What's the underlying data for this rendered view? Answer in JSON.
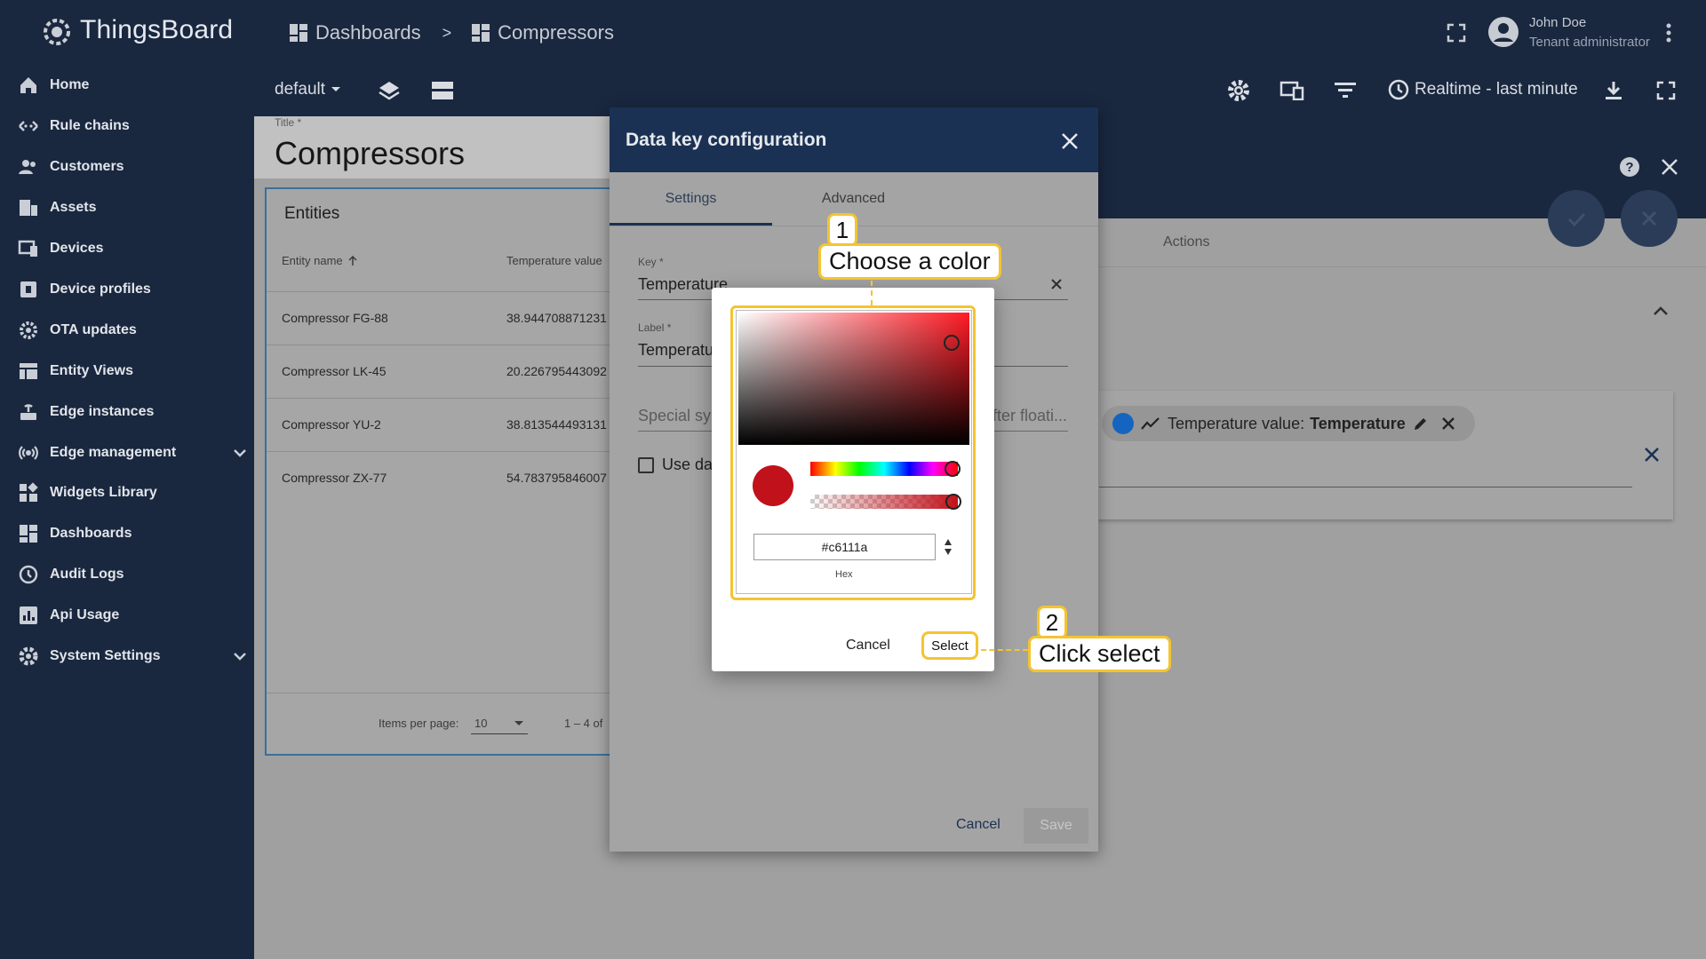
{
  "app": {
    "name": "ThingsBoard"
  },
  "breadcrumb": {
    "dashboards": "Dashboards",
    "separator": ">",
    "current": "Compressors"
  },
  "user": {
    "name": "John Doe",
    "role": "Tenant administrator"
  },
  "sidebar": {
    "items": [
      {
        "label": "Home",
        "icon": "home-icon"
      },
      {
        "label": "Rule chains",
        "icon": "rule-chain-icon"
      },
      {
        "label": "Customers",
        "icon": "customers-icon"
      },
      {
        "label": "Assets",
        "icon": "assets-icon"
      },
      {
        "label": "Devices",
        "icon": "devices-icon"
      },
      {
        "label": "Device profiles",
        "icon": "device-profile-icon"
      },
      {
        "label": "OTA updates",
        "icon": "ota-icon"
      },
      {
        "label": "Entity Views",
        "icon": "entity-views-icon"
      },
      {
        "label": "Edge instances",
        "icon": "edge-icon"
      },
      {
        "label": "Edge management",
        "icon": "edge-management-icon",
        "expandable": true
      },
      {
        "label": "Widgets Library",
        "icon": "widgets-icon"
      },
      {
        "label": "Dashboards",
        "icon": "dashboards-icon"
      },
      {
        "label": "Audit Logs",
        "icon": "audit-icon"
      },
      {
        "label": "Api Usage",
        "icon": "api-usage-icon"
      },
      {
        "label": "System Settings",
        "icon": "settings-icon",
        "expandable": true
      }
    ]
  },
  "toolbar": {
    "state": "default",
    "timewindow": "Realtime - last minute"
  },
  "dashboard": {
    "title_label": "Title *",
    "title": "Compressors",
    "widget_title": "Entities",
    "columns": [
      "Entity name",
      "Temperature value"
    ],
    "rows": [
      {
        "name": "Compressor FG-88",
        "value": "38.944708871231"
      },
      {
        "name": "Compressor LK-45",
        "value": "20.226795443092"
      },
      {
        "name": "Compressor YU-2",
        "value": "38.813544493131"
      },
      {
        "name": "Compressor ZX-77",
        "value": "54.783795846007"
      }
    ],
    "items_per_page_label": "Items per page:",
    "items_per_page": "10",
    "range": "1 – 4 of"
  },
  "widget_editor": {
    "actions_tab": "Actions",
    "datakey_chip_label": "Temperature value:",
    "datakey_chip_key": "Temperature",
    "chip_color": "#1565c0"
  },
  "dialog": {
    "title": "Data key configuration",
    "tabs": [
      "Settings",
      "Advanced"
    ],
    "key_label": "Key *",
    "key_value": "Temperature",
    "label_label": "Label *",
    "label_value": "Temperature value",
    "special_placeholder": "Special sy",
    "decimals_placeholder": "fter floati...",
    "use_data_label": "Use da",
    "cancel": "Cancel",
    "save": "Save"
  },
  "color_picker": {
    "hex_value": "#c6111a",
    "hex_label": "Hex",
    "preview_color": "#c1111a",
    "cancel": "Cancel",
    "select": "Select"
  },
  "callouts": [
    {
      "number": "1",
      "text": "Choose a color"
    },
    {
      "number": "2",
      "text": "Click select"
    }
  ],
  "colors": {
    "navy": "#19273f",
    "dialog_header": "#1b3153",
    "highlight": "#f4c431"
  }
}
